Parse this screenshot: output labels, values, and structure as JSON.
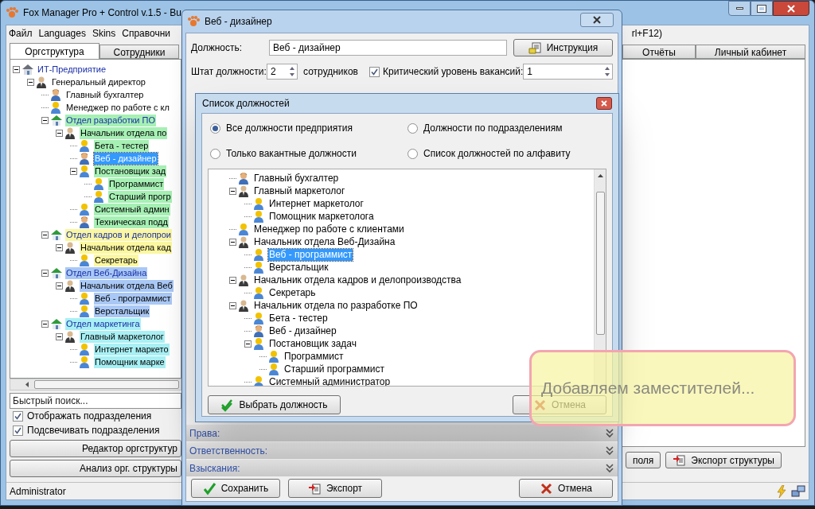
{
  "main_window": {
    "title": "Fox Manager Pro + Control v.1.5 - Bu",
    "menu": [
      "Файл",
      "Languages",
      "Skins",
      "Справочни"
    ],
    "menu_tail": "rl+F12)",
    "tabs": [
      {
        "label": "Оргструктура",
        "selected": true
      },
      {
        "label": "Сотрудники",
        "selected": false
      },
      {
        "label": "Отчёты",
        "selected": false
      },
      {
        "label": "Личный кабинет",
        "selected": false
      }
    ],
    "tree": [
      {
        "label": "ИТ-Предприятие",
        "kind": "company",
        "expanded": true,
        "children": [
          {
            "label": "Генеральный директор",
            "kind": "manager",
            "expanded": true,
            "children": [
              {
                "label": "Главный бухгалтер",
                "kind": "specialist",
                "selected": false
              },
              {
                "label": "Менеджер по работе с кл",
                "kind": "employee",
                "selected": false
              },
              {
                "label": "Отдел разработки ПО",
                "kind": "department",
                "color": "#a6f0b4",
                "expanded": true,
                "children": [
                  {
                    "label": "Начальник отдела по",
                    "kind": "manager",
                    "expanded": true,
                    "children": [
                      {
                        "label": "Бета - тестер",
                        "kind": "employee",
                        "selected": false
                      },
                      {
                        "label": "Веб - дизайнер",
                        "kind": "specialist",
                        "selected": true
                      },
                      {
                        "label": "Постановщик зад",
                        "kind": "employee",
                        "expanded": true,
                        "children": [
                          {
                            "label": "Программист",
                            "kind": "employee",
                            "selected": false
                          },
                          {
                            "label": "Старший прогр",
                            "kind": "employee",
                            "selected": false
                          }
                        ]
                      },
                      {
                        "label": "Системный админ",
                        "kind": "employee",
                        "selected": false
                      },
                      {
                        "label": "Техническая подд",
                        "kind": "specialist",
                        "selected": false
                      }
                    ]
                  }
                ]
              },
              {
                "label": "Отдел кадров и делопрои",
                "kind": "department",
                "color": "#fbf7a0",
                "expanded": true,
                "children": [
                  {
                    "label": "Начальник отдела кад",
                    "kind": "manager",
                    "expanded": true,
                    "children": [
                      {
                        "label": "Секретарь",
                        "kind": "employee",
                        "selected": false
                      }
                    ]
                  }
                ]
              },
              {
                "label": "Отдел Веб-Дизайна",
                "kind": "department",
                "color": "#a9c8f5",
                "expanded": true,
                "children": [
                  {
                    "label": "Начальник отдела Веб",
                    "kind": "manager",
                    "expanded": true,
                    "children": [
                      {
                        "label": "Веб - программист",
                        "kind": "employee",
                        "selected": false
                      },
                      {
                        "label": "Верстальщик",
                        "kind": "employee",
                        "selected": false
                      }
                    ]
                  }
                ]
              },
              {
                "label": "Отдел маркетинга",
                "kind": "department",
                "color": "#a8f0f4",
                "expanded": true,
                "children": [
                  {
                    "label": "Главный маркетолог",
                    "kind": "manager",
                    "expanded": true,
                    "children": [
                      {
                        "label": "Интернет маркето",
                        "kind": "employee",
                        "selected": false
                      },
                      {
                        "label": "Помощник марке",
                        "kind": "employee",
                        "selected": false
                      }
                    ]
                  }
                ]
              }
            ]
          }
        ]
      }
    ],
    "search": {
      "placeholder": "Быстрый поиск..."
    },
    "options": [
      {
        "label": "Отображать подразделения",
        "checked": true
      },
      {
        "label": "Подсвечивать подразделения",
        "checked": true
      }
    ],
    "buttons": [
      "Редактор оргструктур",
      "Анализ орг. структуры"
    ],
    "right_buttons": [
      {
        "label": "поля",
        "kind": "plain"
      },
      {
        "label": "Экспорт структуры",
        "kind": "export"
      }
    ],
    "status_bar": {
      "user": "Administrator"
    }
  },
  "position_window": {
    "title": "Веб - дизайнер",
    "position": {
      "label": "Должность:",
      "value": "Веб - дизайнер"
    },
    "instruction_button": "Инструкция",
    "staff": {
      "label": "Штат должности:",
      "value": "2",
      "unit": "сотрудников"
    },
    "critical": {
      "label": "Критический уровень вакансий:",
      "checked": true,
      "value": "1"
    },
    "sections": [
      "Права:",
      "Ответственность:",
      "Взыскания:"
    ],
    "buttons": [
      {
        "label": "Сохранить",
        "kind": "save"
      },
      {
        "label": "Экспорт",
        "kind": "export"
      },
      {
        "label": "Отмена",
        "kind": "cancel"
      }
    ]
  },
  "list_dialog": {
    "title": "Список должностей",
    "modes": [
      {
        "label": "Все должности предприятия",
        "selected": true
      },
      {
        "label": "Должности по подразделениям",
        "selected": false
      },
      {
        "label": "Только вакантные должности",
        "selected": false
      },
      {
        "label": "Список должностей по алфавиту",
        "selected": false
      }
    ],
    "tree": [
      {
        "label": "Главный бухгалтер",
        "kind": "specialist",
        "selected": false
      },
      {
        "label": "Главный маркетолог",
        "kind": "manager",
        "expanded": true,
        "children": [
          {
            "label": "Интернет маркетолог",
            "kind": "employee",
            "selected": false
          },
          {
            "label": "Помощник маркетолога",
            "kind": "employee",
            "selected": false
          }
        ]
      },
      {
        "label": "Менеджер по работе с клиентами",
        "kind": "employee",
        "selected": false
      },
      {
        "label": "Начальник отдела Веб-Дизайна",
        "kind": "manager",
        "expanded": true,
        "children": [
          {
            "label": "Веб - программист",
            "kind": "employee",
            "selected": true
          },
          {
            "label": "Верстальщик",
            "kind": "employee",
            "selected": false
          }
        ]
      },
      {
        "label": "Начальник отдела кадров и делопроизводства",
        "kind": "manager",
        "expanded": true,
        "children": [
          {
            "label": "Секретарь",
            "kind": "employee",
            "selected": false
          }
        ]
      },
      {
        "label": "Начальник отдела по разработке ПО",
        "kind": "manager",
        "expanded": true,
        "children": [
          {
            "label": "Бета - тестер",
            "kind": "employee",
            "selected": false
          },
          {
            "label": "Веб - дизайнер",
            "kind": "specialist",
            "selected": false
          },
          {
            "label": "Постановщик задач",
            "kind": "employee",
            "expanded": true,
            "children": [
              {
                "label": "Программист",
                "kind": "employee",
                "selected": false
              },
              {
                "label": "Старший программист",
                "kind": "employee",
                "selected": false
              }
            ]
          },
          {
            "label": "Системный администратор",
            "kind": "employee",
            "selected": false
          }
        ]
      }
    ],
    "buttons": [
      {
        "label": "Выбрать должность",
        "kind": "select"
      },
      {
        "label": "Отмена",
        "kind": "cancel"
      }
    ]
  },
  "callout": {
    "text": "Добавляем заместителей..."
  }
}
